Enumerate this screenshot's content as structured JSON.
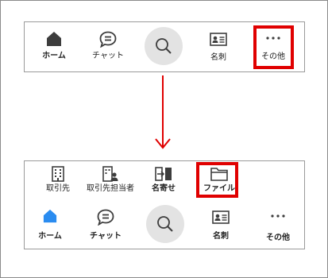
{
  "top_bar": {
    "items": [
      {
        "label": "ホーム",
        "icon": "home-icon"
      },
      {
        "label": "チャット",
        "icon": "chat-icon"
      },
      {
        "label": "",
        "icon": "search-icon"
      },
      {
        "label": "名刺",
        "icon": "business-card-icon"
      },
      {
        "label": "その他",
        "icon": "more-dots-icon"
      }
    ]
  },
  "bottom_bar": {
    "sub_items": [
      {
        "label": "取引先",
        "icon": "building-icon"
      },
      {
        "label": "取引先担当者",
        "icon": "contact-person-icon"
      },
      {
        "label": "名寄せ",
        "icon": "merge-icon"
      },
      {
        "label": "ファイル",
        "icon": "folder-icon"
      }
    ],
    "items": [
      {
        "label": "ホーム",
        "icon": "home-icon"
      },
      {
        "label": "チャット",
        "icon": "chat-icon"
      },
      {
        "label": "",
        "icon": "search-icon"
      },
      {
        "label": "名刺",
        "icon": "business-card-icon"
      },
      {
        "label": "その他",
        "icon": "more-dots-icon"
      }
    ]
  },
  "colors": {
    "highlight": "#e00000",
    "active_home_blue": "#2a8cf0",
    "icon_dark": "#3d3d3d"
  }
}
